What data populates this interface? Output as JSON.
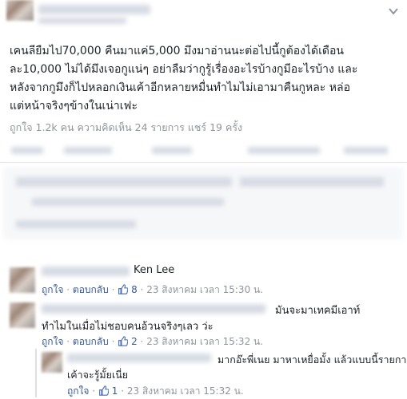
{
  "post": {
    "text_lines": [
      "เคนลียืมไป70,000 คืนมาแค่5,000 มึงมาอ่านนะต่อไปนี้กูต้องได้เดือน",
      "ละ10,000 ไม่ได้มึงเจอกูแน่ๆ อย่าลืมว่ากูรู้เรื่องอะไรบ้างกูมีอะไรบ้าง และ",
      "หลังจากกูมึงก็ไปหลอกเงินเค้าอีกหลายหมื่นทำไมไม่เอามาคืนกูหละ หล่อ",
      "แต่หน้าจริงๆข้างในเน่าเฟะ"
    ],
    "stats": "ถูกใจ 1.2k คน  ความคิดเห็น 24 รายการ  แชร์ 19 ครั้ง"
  },
  "comments": [
    {
      "name": "Ken Lee",
      "text": "",
      "like_label": "ถูกใจ",
      "reply_label": "ตอบกลับ",
      "like_count": "8",
      "timestamp": "23 สิงหาคม เวลา 15:30 น."
    },
    {
      "name": "",
      "text_first": "มันจะมาเทคมีเอาท์",
      "text_second": "ทำไมในเมื่อไม่ชอบคนอ้วนจริงๆเลว ว่ะ",
      "like_label": "ถูกใจ",
      "reply_label": "ตอบกลับ",
      "like_count": "2",
      "timestamp": "23 สิงหาคม เวลา 15:32 น."
    },
    {
      "name": "",
      "text_first": "มากอ๊ะพี่เนย มาหาเหยื่อมั้ง แล้วแบบนี้รายการ",
      "text_second": "เค้าจะรู้มั้ยเนี่ย",
      "like_label": "ถูกใจ",
      "like_count": "1",
      "timestamp": "23 สิงหาคม เวลา 15:32 น."
    }
  ],
  "icons": {
    "chevron": "chevron-down-icon",
    "thumb": "thumbs-up-icon"
  },
  "colors": {
    "link": "#365899",
    "meta": "#90949c",
    "text": "#1d2129"
  }
}
